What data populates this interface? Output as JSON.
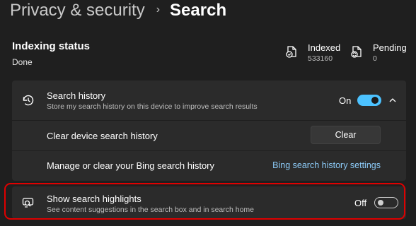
{
  "breadcrumb": {
    "parent": "Privacy & security",
    "separator": "›",
    "current": "Search"
  },
  "indexing": {
    "title": "Indexing status",
    "value": "Done",
    "indexed_label": "Indexed",
    "indexed_count": "533160",
    "pending_label": "Pending",
    "pending_count": "0"
  },
  "search_history": {
    "title": "Search history",
    "subtitle": "Store my search history on this device to improve search results",
    "state_label": "On",
    "enabled": true,
    "icon": "history-icon",
    "clear_device": {
      "label": "Clear device search history",
      "button": "Clear"
    },
    "bing": {
      "label": "Manage or clear your Bing search history",
      "link": "Bing search history settings"
    }
  },
  "search_highlights": {
    "title": "Show search highlights",
    "subtitle": "See content suggestions in the search box and in search home",
    "state_label": "Off",
    "enabled": false,
    "icon": "search-highlights-icon"
  },
  "colors": {
    "accent": "#4cc2ff",
    "link": "#8ccaf7",
    "annotation_ring": "#e00000"
  }
}
